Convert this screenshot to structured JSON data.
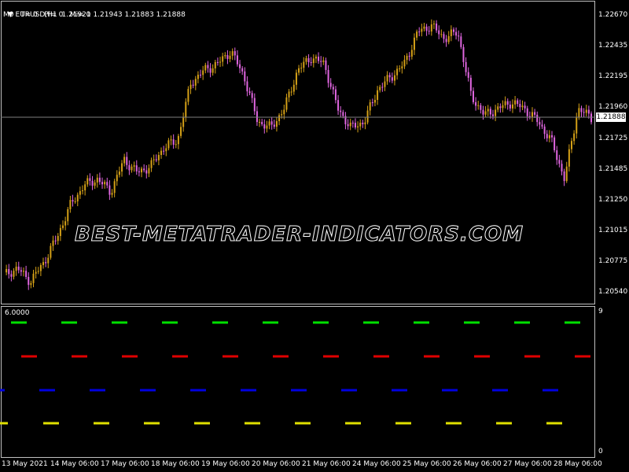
{
  "header": {
    "symbol_line": "EURUSD,H1  1.21921 1.21943 1.21883 1.21888",
    "status_line": "M0   T= 0   Pl= 0   Mi= 0",
    "symbol_arrow_icon": "triangle-down-icon"
  },
  "price_axis": {
    "labels": [
      "1.22670",
      "1.22435",
      "1.22195",
      "1.21960",
      "1.21725",
      "1.21485",
      "1.21250",
      "1.21015",
      "1.20775",
      "1.20540"
    ],
    "current_price": "1.21888"
  },
  "indicator": {
    "value_label": "6.0000",
    "scale_top": "9",
    "scale_bottom": "0",
    "colors": [
      "#00e000",
      "#e00000",
      "#0000e0",
      "#e0e000"
    ]
  },
  "time_axis": {
    "labels": [
      "13 May 2021",
      "14 May 06:00",
      "17 May 06:00",
      "18 May 06:00",
      "19 May 06:00",
      "20 May 06:00",
      "21 May 06:00",
      "24 May 06:00",
      "25 May 06:00",
      "26 May 06:00",
      "27 May 06:00",
      "28 May 06:00"
    ]
  },
  "watermark": "BEST-METATRADER-INDICATORS.COM",
  "chart_data": {
    "type": "candlestick",
    "symbol": "EURUSD",
    "timeframe": "H1",
    "ylim": [
      1.2045,
      1.2275
    ],
    "close_trace": [
      1.2065,
      1.207,
      1.206,
      1.2075,
      1.2095,
      1.212,
      1.2135,
      1.214,
      1.213,
      1.2155,
      1.2145,
      1.215,
      1.2165,
      1.217,
      1.2215,
      1.2225,
      1.223,
      1.224,
      1.222,
      1.2185,
      1.218,
      1.2195,
      1.2225,
      1.2235,
      1.223,
      1.2195,
      1.218,
      1.2185,
      1.221,
      1.222,
      1.223,
      1.2255,
      1.226,
      1.225,
      1.2255,
      1.2205,
      1.219,
      1.2195,
      1.22,
      1.2195,
      1.2185,
      1.217,
      1.214,
      1.2195,
      1.2188
    ],
    "colors": {
      "up": "#d4a017",
      "down": "#e066e0"
    }
  }
}
